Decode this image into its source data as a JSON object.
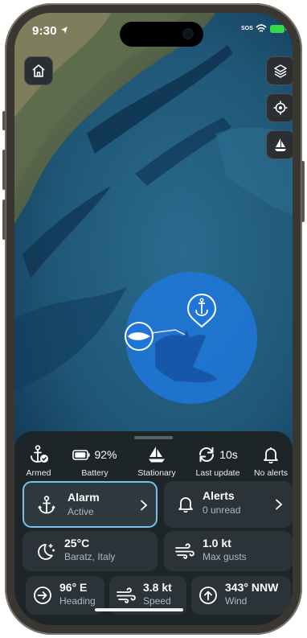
{
  "status_bar": {
    "time": "9:30",
    "sos": "SOS"
  },
  "map_controls": [
    {
      "name": "home-button",
      "icon": "home-icon"
    },
    {
      "name": "layers-button",
      "icon": "layers-icon"
    },
    {
      "name": "locate-button",
      "icon": "target-icon"
    },
    {
      "name": "boat-button",
      "icon": "sailboat-icon"
    }
  ],
  "stats": {
    "armed": {
      "label": "Armed",
      "icon": "anchor-check-icon"
    },
    "battery": {
      "value": "92%",
      "label": "Battery",
      "icon": "battery-icon"
    },
    "stationary": {
      "label": "Stationary",
      "icon": "sailboat-icon"
    },
    "last_update": {
      "value": "10s",
      "label": "Last update",
      "icon": "refresh-icon"
    },
    "alerts": {
      "label": "No alerts",
      "icon": "bell-icon"
    }
  },
  "cards": {
    "alarm": {
      "title": "Alarm",
      "subtitle": "Active"
    },
    "alerts": {
      "title": "Alerts",
      "subtitle": "0 unread"
    },
    "weather": {
      "title": "25°C",
      "subtitle": "Baratz, Italy"
    },
    "gusts": {
      "title": "1.0 kt",
      "subtitle": "Max gusts"
    },
    "heading": {
      "title": "96° E",
      "subtitle": "Heading"
    },
    "speed": {
      "title": "3.8 kt",
      "subtitle": "Speed"
    },
    "wind": {
      "title": "343° NNW",
      "subtitle": "Wind"
    }
  },
  "colors": {
    "accent": "#78c0e6",
    "zone": "#1f76d8",
    "battery_ok": "#37d74b"
  }
}
